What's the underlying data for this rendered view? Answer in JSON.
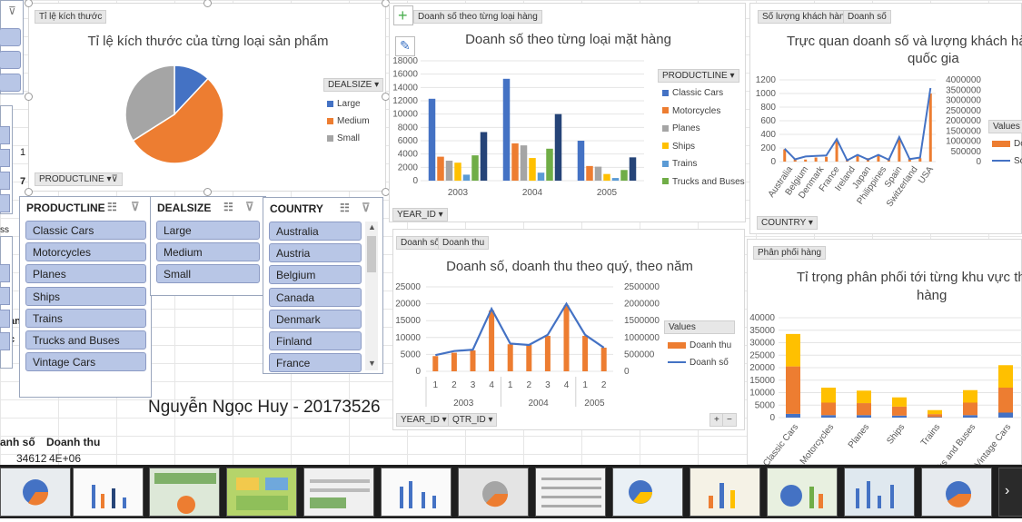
{
  "tags": {
    "size_ratio": "Tỉ lệ kích thước",
    "sales_by_type": "Doanh số theo từng loại hàng",
    "customers": "Số lượng khách hàng",
    "sales": "Doanh số",
    "revenue": "Doanh thu",
    "distribution": "Phân phối hàng",
    "productline_field": "PRODUCTLINE",
    "dealsize_field": "DEALSIZE",
    "year_field": "YEAR_ID",
    "qtr_field": "QTR_ID",
    "country_field": "COUNTRY",
    "values": "Values"
  },
  "pie": {
    "title": "Tỉ lệ kích thước của từng loại sản phẩm",
    "legend": [
      "Large",
      "Medium",
      "Small"
    ],
    "colors": [
      "#4472c4",
      "#ed7d31",
      "#a5a5a5"
    ],
    "chart_data": {
      "type": "pie",
      "labels": [
        "Large",
        "Medium",
        "Small"
      ],
      "values": [
        12,
        54,
        34
      ]
    }
  },
  "bar": {
    "title": "Doanh số theo từng loại mặt hàng",
    "legend": [
      "Classic Cars",
      "Motorcycles",
      "Planes",
      "Ships",
      "Trains",
      "Trucks and Buses"
    ],
    "colors": [
      "#4472c4",
      "#ed7d31",
      "#a5a5a5",
      "#ffc000",
      "#5b9bd5",
      "#70ad47",
      "#264478"
    ],
    "yticks": [
      "0",
      "2000",
      "4000",
      "6000",
      "8000",
      "10000",
      "12000",
      "14000",
      "16000",
      "18000"
    ],
    "chart_data": {
      "type": "bar",
      "categories": [
        "2003",
        "2004",
        "2005"
      ],
      "ylim": [
        0,
        18000
      ],
      "series": [
        {
          "name": "Classic Cars",
          "values": [
            12300,
            15300,
            6000
          ]
        },
        {
          "name": "Motorcycles",
          "values": [
            3600,
            5600,
            2200
          ]
        },
        {
          "name": "Planes",
          "values": [
            3000,
            5300,
            2100
          ]
        },
        {
          "name": "Ships",
          "values": [
            2700,
            3400,
            1000
          ]
        },
        {
          "name": "Trains",
          "values": [
            900,
            1200,
            400
          ]
        },
        {
          "name": "Trucks and Buses",
          "values": [
            3800,
            4800,
            1600
          ]
        },
        {
          "name": "",
          "values": [
            7300,
            10000,
            3500
          ]
        }
      ]
    }
  },
  "country": {
    "title_line1": "Trực quan doanh số và lượng khách hà",
    "title_line2": "quốc gia",
    "legend": [
      "Do",
      "Sc"
    ],
    "yticks_left": [
      "0",
      "200",
      "400",
      "600",
      "800",
      "1000",
      "1200"
    ],
    "yticks_right": [
      "0",
      "500000",
      "1000000",
      "1500000",
      "2000000",
      "2500000",
      "3000000",
      "3500000",
      "4000000"
    ],
    "chart_data": {
      "type": "bar",
      "categories": [
        "Australia",
        "Belgium",
        "Denmark",
        "France",
        "Ireland",
        "Japan",
        "Philippines",
        "Spain",
        "Switzerland",
        "USA"
      ],
      "ylim": [
        0,
        1200
      ],
      "ylim_right": [
        0,
        4000000
      ],
      "series": [
        {
          "name": "Doanh thu",
          "values": [
            180,
            40,
            30,
            60,
            70,
            300,
            20,
            80,
            50,
            90,
            30,
            340,
            40,
            50,
            1000
          ]
        },
        {
          "name": "Doanh số",
          "values": [
            630000,
            110000,
            250000,
            280000,
            300000,
            1100000,
            60000,
            330000,
            100000,
            330000,
            90000,
            1200000,
            120000,
            200000,
            3600000
          ]
        }
      ]
    }
  },
  "quarter": {
    "title": "Doanh số, doanh thu theo quý, theo năm",
    "legend": [
      "Doanh thu",
      "Doanh số"
    ],
    "yticks_left": [
      "0",
      "5000",
      "10000",
      "15000",
      "20000",
      "25000"
    ],
    "yticks_right": [
      "0",
      "500000",
      "1000000",
      "1500000",
      "2000000",
      "2500000"
    ],
    "quarters": [
      "1",
      "2",
      "3",
      "4",
      "1",
      "2",
      "3",
      "4",
      "1",
      "2"
    ],
    "years": [
      "2003",
      "2004",
      "2005"
    ],
    "chart_data": {
      "type": "bar",
      "categories": [
        "2003-1",
        "2003-2",
        "2003-3",
        "2003-4",
        "2004-1",
        "2004-2",
        "2004-3",
        "2004-4",
        "2005-1",
        "2005-2"
      ],
      "ylim": [
        0,
        25000
      ],
      "ylim_right": [
        0,
        2500000
      ],
      "series": [
        {
          "name": "Doanh thu",
          "values": [
            4500,
            5500,
            6200,
            18000,
            8000,
            7800,
            10500,
            19500,
            10500,
            7000
          ]
        },
        {
          "name": "Doanh số",
          "values": [
            480000,
            600000,
            640000,
            1850000,
            820000,
            780000,
            1080000,
            2000000,
            1080000,
            700000
          ]
        }
      ]
    }
  },
  "distribution": {
    "title_line1": "Tỉ trọng phân phối tới từng khu vực th",
    "title_line2": "hàng",
    "yticks": [
      "0",
      "5000",
      "10000",
      "15000",
      "20000",
      "25000",
      "30000",
      "35000",
      "40000"
    ],
    "chart_data": {
      "type": "bar",
      "categories": [
        "Classic Cars",
        "Motorcycles",
        "Planes",
        "Ships",
        "Trains",
        "Trucks and Buses",
        "Vintage Cars"
      ],
      "ylim": [
        0,
        40000
      ],
      "series": [
        {
          "name": "",
          "values": [
            1500,
            1000,
            1000,
            800,
            200,
            1000,
            2000
          ]
        },
        {
          "name": "",
          "values": [
            19000,
            5000,
            4800,
            3600,
            1200,
            5000,
            10000
          ]
        },
        {
          "name": "",
          "values": [
            13000,
            6000,
            5000,
            3700,
            1600,
            5000,
            9000
          ]
        }
      ]
    }
  },
  "slicers": {
    "productline": {
      "title": "PRODUCTLINE",
      "items": [
        "Classic Cars",
        "Motorcycles",
        "Planes",
        "Ships",
        "Trains",
        "Trucks and Buses",
        "Vintage Cars"
      ]
    },
    "dealsize": {
      "title": "DEALSIZE",
      "items": [
        "Large",
        "Medium",
        "Small"
      ]
    },
    "country": {
      "title": "COUNTRY",
      "items": [
        "Australia",
        "Austria",
        "Belgium",
        "Canada",
        "Denmark",
        "Finland",
        "France"
      ]
    }
  },
  "author": "Nguyễn Ngọc Huy - 20173526",
  "sheet": {
    "col1": "anh số",
    "col2": "Doanh thu",
    "val1": "34612",
    "val2": "4E+06"
  },
  "edge_fragments": {
    "a": "1",
    "b": "7",
    "c": "ss",
    "d": "àn",
    "e": "c"
  }
}
